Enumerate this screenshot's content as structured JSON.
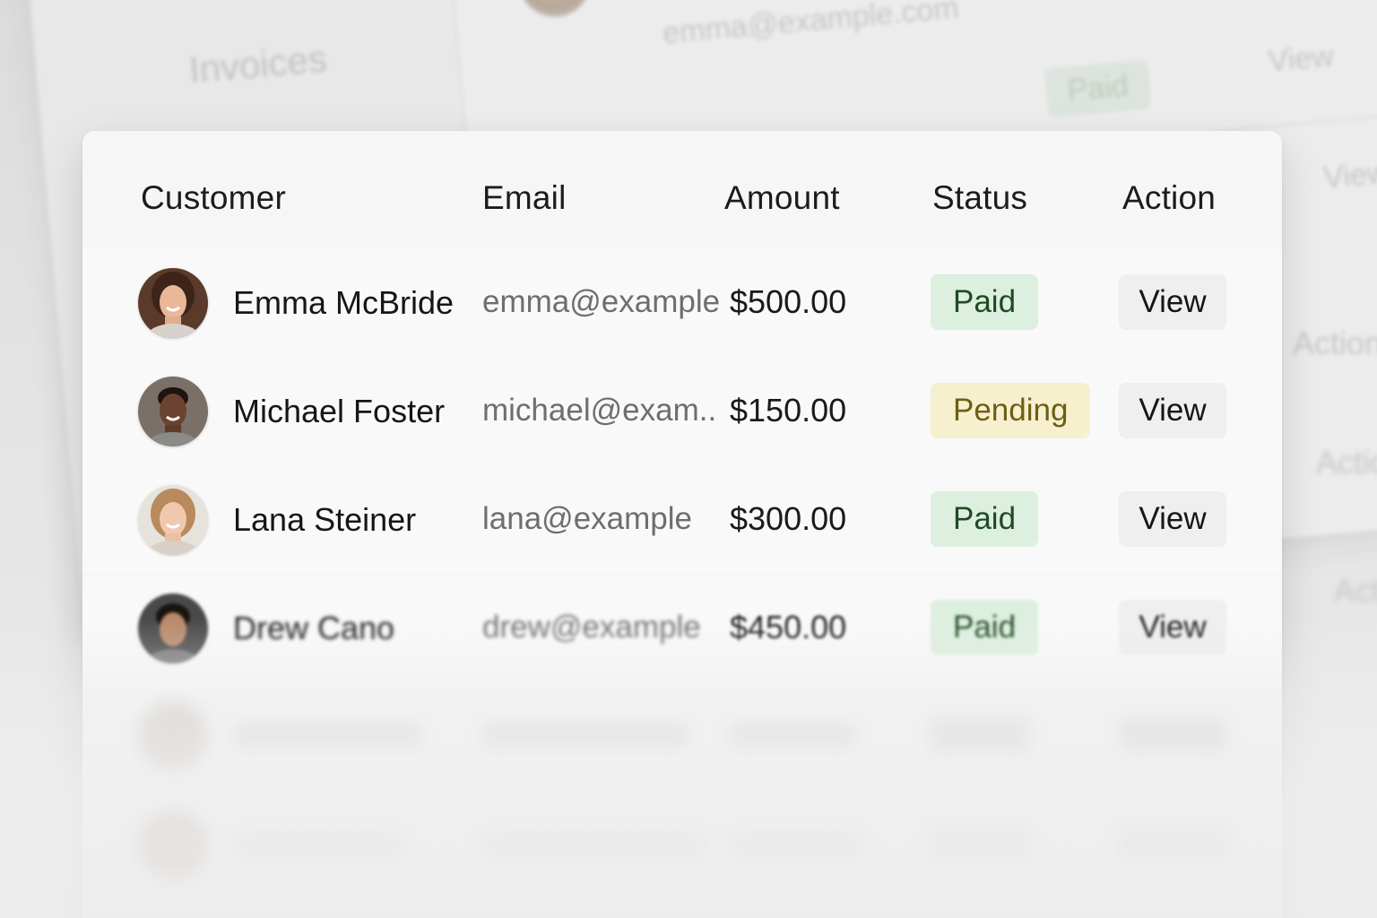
{
  "background_window": {
    "title": "Invoices",
    "email": "emma@example.com",
    "status": "Paid",
    "action_labels": [
      "View",
      "View",
      "Action",
      "Action",
      "Act"
    ],
    "partial_text": "emma"
  },
  "table": {
    "headers": [
      "Customer",
      "Email",
      "Amount",
      "Status",
      "Action"
    ],
    "rows": [
      {
        "name": "Emma McBride",
        "email": "emma@example",
        "amount": "$500.00",
        "status": "Paid",
        "action": "View"
      },
      {
        "name": "Michael Foster",
        "email": "michael@exam..",
        "amount": "$150.00",
        "status": "Pending",
        "action": "View"
      },
      {
        "name": "Lana Steiner",
        "email": "lana@example",
        "amount": "$300.00",
        "status": "Paid",
        "action": "View"
      },
      {
        "name": "Drew Cano",
        "email": "drew@example",
        "amount": "$450.00",
        "status": "Paid",
        "action": "View"
      }
    ]
  },
  "colors": {
    "paid_bg": "#ddefdf",
    "paid_text": "#1f4a23",
    "pending_bg": "#f6f0cf",
    "pending_text": "#6e5e12",
    "view_bg": "#efefef"
  }
}
